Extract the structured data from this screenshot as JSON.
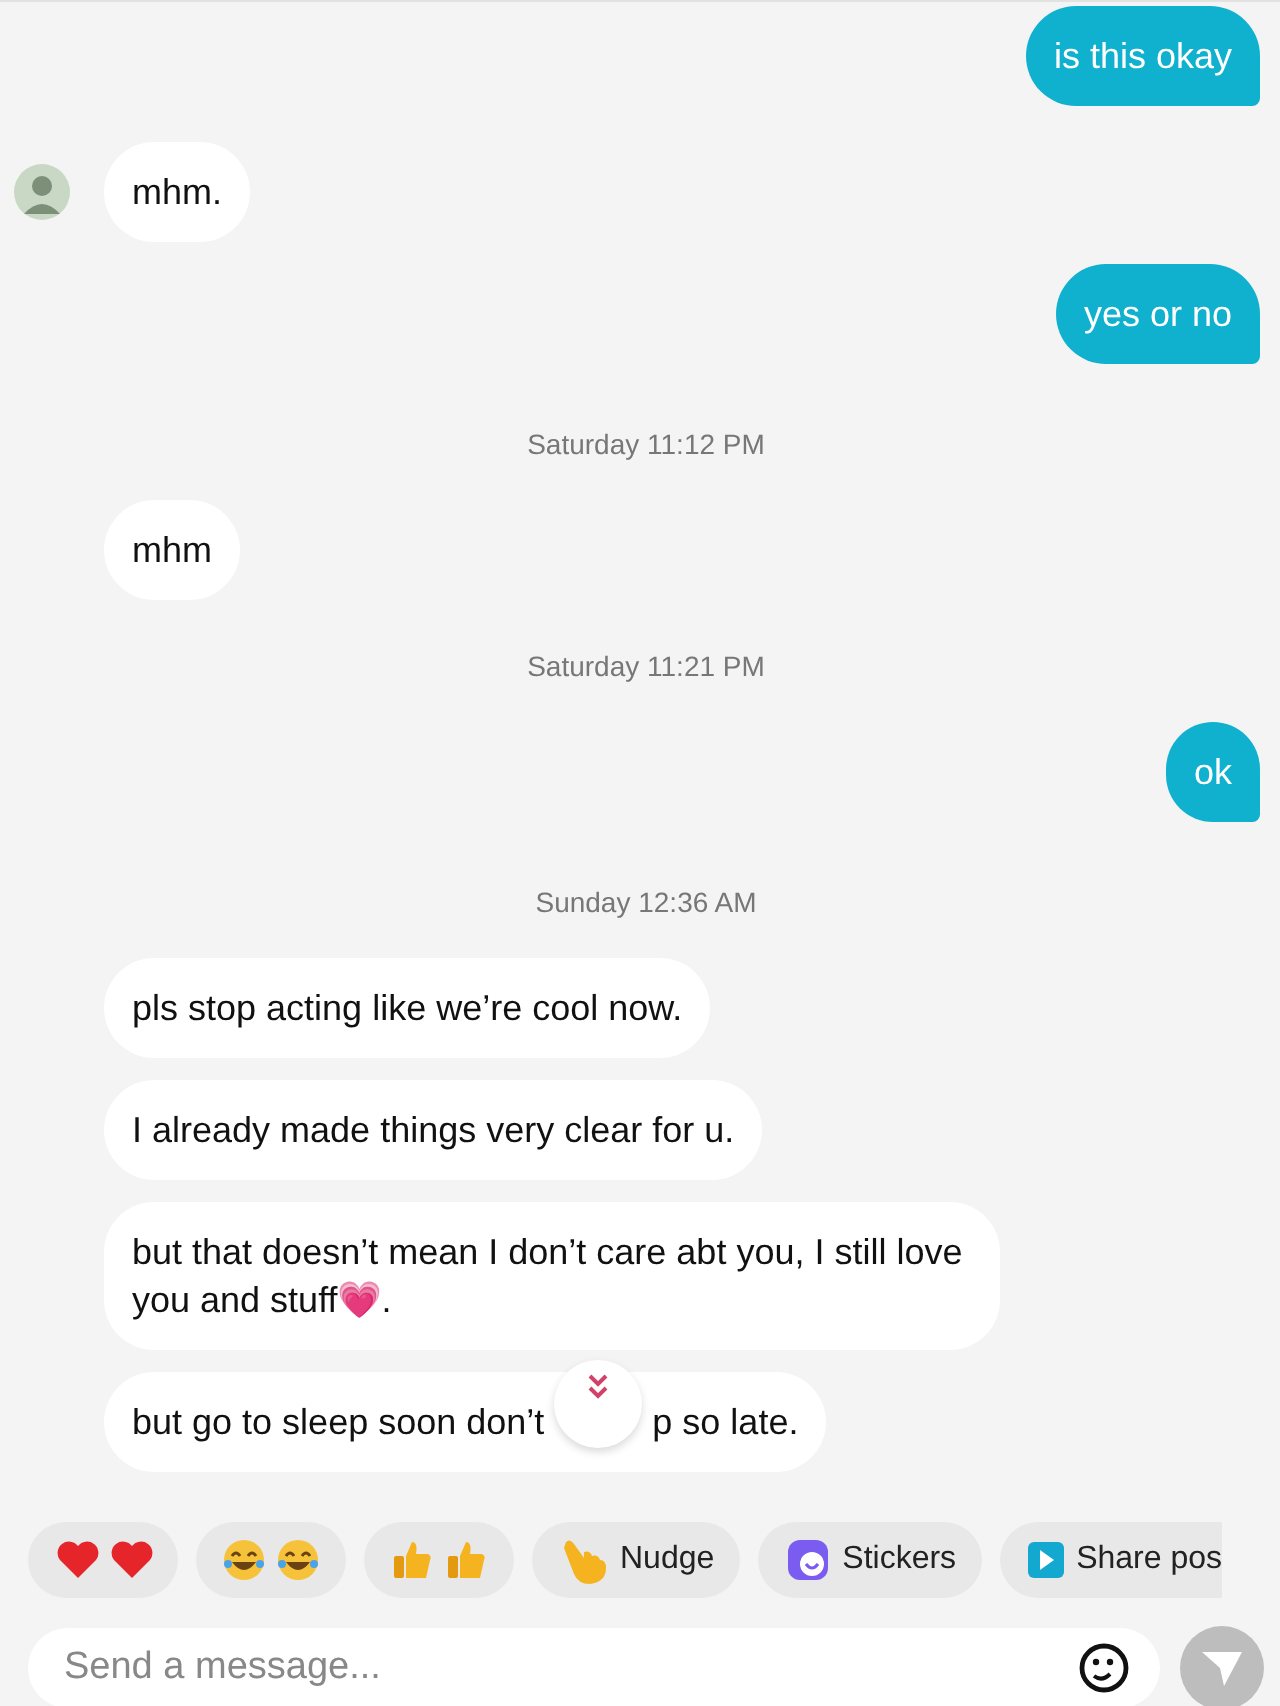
{
  "messages": [
    {
      "kind": "outgoing",
      "text": "is this okay"
    },
    {
      "kind": "incoming",
      "text": "mhm.",
      "show_avatar": true
    },
    {
      "kind": "outgoing",
      "text": "yes or no"
    },
    {
      "kind": "timestamp",
      "text": "Saturday 11:12 PM"
    },
    {
      "kind": "incoming",
      "text": "mhm",
      "show_avatar": false
    },
    {
      "kind": "timestamp",
      "text": "Saturday 11:21 PM"
    },
    {
      "kind": "outgoing",
      "text": "ok"
    },
    {
      "kind": "timestamp",
      "text": "Sunday 12:36 AM"
    },
    {
      "kind": "incoming",
      "text": "pls stop acting like we’re cool now.",
      "show_avatar": false
    },
    {
      "kind": "incoming",
      "text": "I already made things very clear for u.",
      "show_avatar": false
    },
    {
      "kind": "incoming",
      "text": "but that doesn’t mean I don’t care abt you, I still love you and stuff💗.",
      "show_avatar": false
    },
    {
      "kind": "covered",
      "text_before": "but go to sleep soon don’t",
      "text_after": "p so late."
    }
  ],
  "quick_replies": [
    {
      "kind": "hearts"
    },
    {
      "kind": "laughs"
    },
    {
      "kind": "thumbs"
    },
    {
      "kind": "nudge",
      "label": "Nudge"
    },
    {
      "kind": "stickers",
      "label": "Stickers"
    },
    {
      "kind": "share",
      "label": "Share pos"
    }
  ],
  "composer": {
    "placeholder": "Send a message..."
  }
}
